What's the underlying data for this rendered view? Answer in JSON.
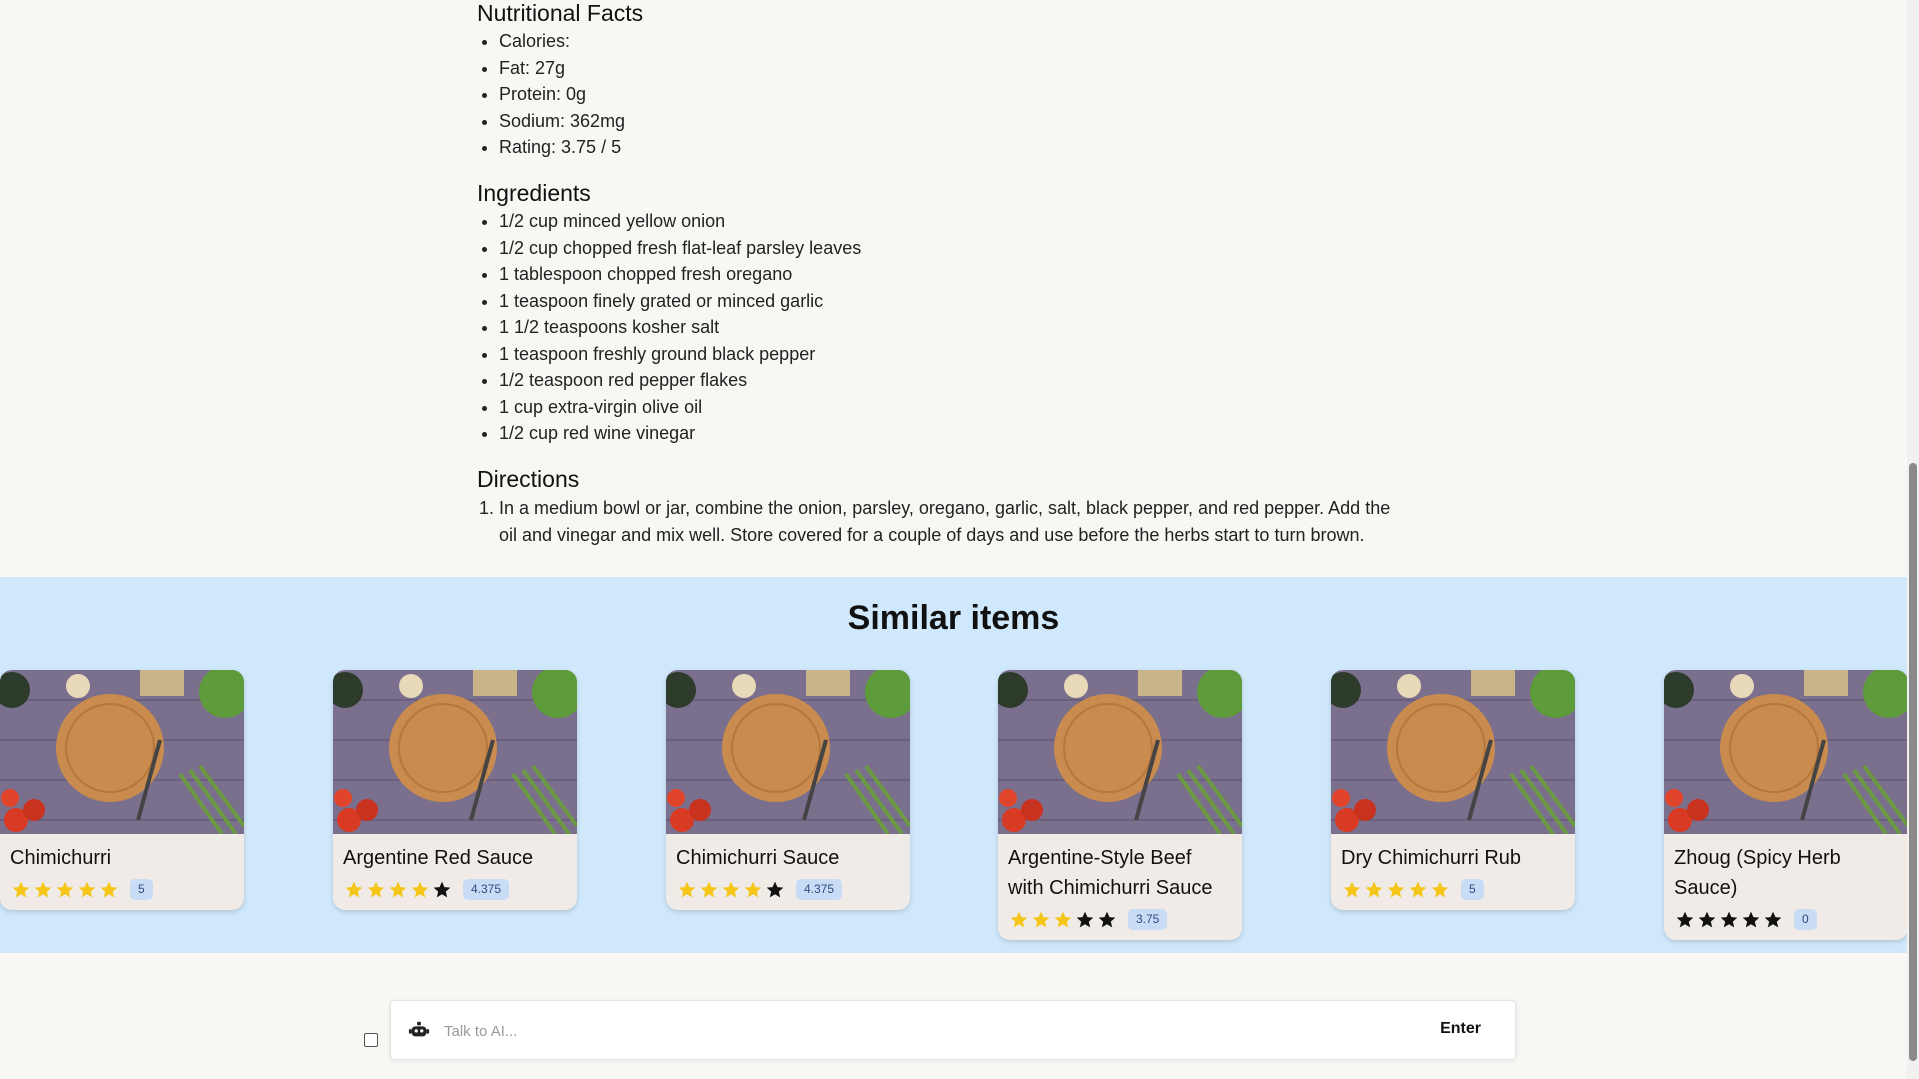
{
  "nutrition": {
    "heading": "Nutritional Facts",
    "items": [
      "Calories:",
      "Fat: 27g",
      "Protein: 0g",
      "Sodium: 362mg",
      "Rating: 3.75 / 5"
    ]
  },
  "ingredients": {
    "heading": "Ingredients",
    "items": [
      "1/2 cup minced yellow onion",
      "1/2 cup chopped fresh flat-leaf parsley leaves",
      "1 tablespoon chopped fresh oregano",
      "1 teaspoon finely grated or minced garlic",
      "1 1/2 teaspoons kosher salt",
      "1 teaspoon freshly ground black pepper",
      "1/2 teaspoon red pepper flakes",
      "1 cup extra-virgin olive oil",
      "1/2 cup red wine vinegar"
    ]
  },
  "directions": {
    "heading": "Directions",
    "steps": [
      "In a medium bowl or jar, combine the onion, parsley, oregano, garlic, salt, black pepper, and red pepper. Add the oil and vinegar and mix well. Store covered for a couple of days and use before the herbs start to turn brown."
    ]
  },
  "similar": {
    "heading": "Similar items",
    "items": [
      {
        "title": "Chimichurri",
        "rating": 5,
        "badge": "5"
      },
      {
        "title": "Argentine Red Sauce",
        "rating": 4.375,
        "badge": "4.375"
      },
      {
        "title": "Chimichurri Sauce",
        "rating": 4.375,
        "badge": "4.375"
      },
      {
        "title": "Argentine-Style Beef with Chimichurri Sauce",
        "rating": 3.75,
        "badge": "3.75"
      },
      {
        "title": "Dry Chimichurri Rub",
        "rating": 5,
        "badge": "5"
      },
      {
        "title": "Zhoug (Spicy Herb Sauce)",
        "rating": 0,
        "badge": "0"
      }
    ]
  },
  "chat": {
    "placeholder": "Talk to AI...",
    "enter_label": "Enter",
    "icon": "robot-icon"
  },
  "colors": {
    "page_bg": "#f9f7f4",
    "similar_bg": "#cfe8fb",
    "card_bg": "#f0ebe6",
    "star_filled": "#f5c518",
    "star_empty": "#111111",
    "badge_bg": "#c9dcf6"
  }
}
